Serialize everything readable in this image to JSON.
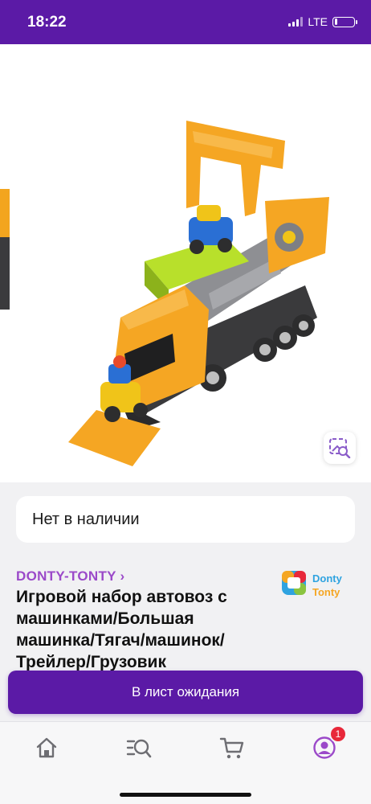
{
  "status_bar": {
    "time": "18:22",
    "network": "LTE",
    "battery_level": 0.15
  },
  "photo": {
    "back_icon": "chevron-left-icon",
    "share_icon": "share-icon",
    "visual_search_icon": "image-search-icon",
    "subject": "toy-truck-carrier"
  },
  "availability": {
    "label": "Нет в наличии"
  },
  "product": {
    "brand": "DONTY-TONTY ›",
    "brand_logo_line1": "Donty",
    "brand_logo_line2": "Tonty",
    "title": "Игровой набор автовоз с машинками/Большая машинка/Тягач/машинок/Трейлер/Грузовик"
  },
  "waitlist": {
    "label": "В лист ожидания"
  },
  "tab_bar": {
    "items": [
      {
        "icon": "home-icon"
      },
      {
        "icon": "catalog-search-icon"
      },
      {
        "icon": "cart-icon"
      },
      {
        "icon": "profile-icon",
        "badge": "1"
      }
    ]
  },
  "colors": {
    "brand_purple": "#5b1aa6",
    "brand_link": "#9b49c9",
    "badge_red": "#e8283a"
  }
}
